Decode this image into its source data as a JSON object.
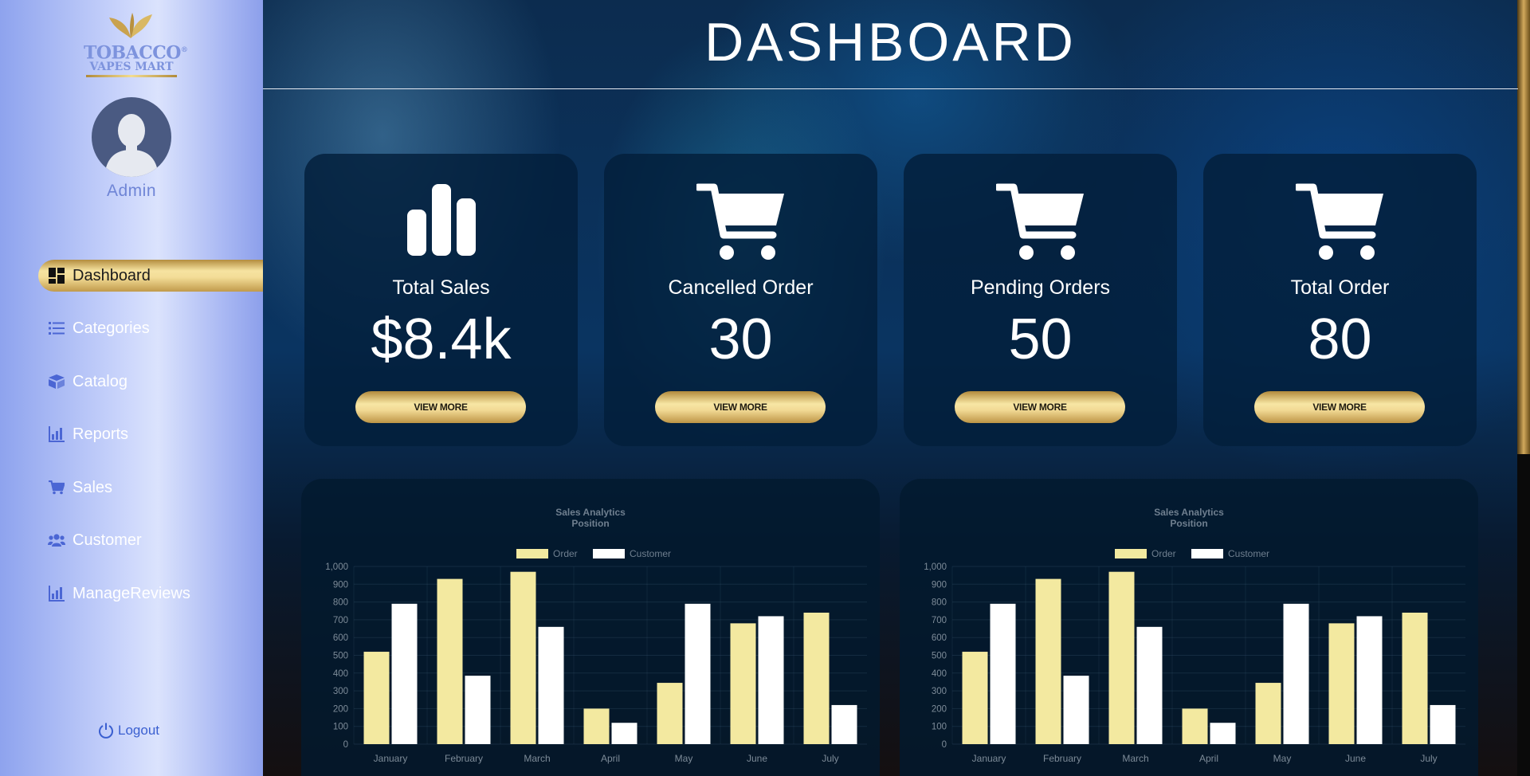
{
  "brand": {
    "line1": "TOBACCO",
    "line2": "VAPES MART",
    "registered": "®"
  },
  "user": {
    "name": "Admin"
  },
  "nav": [
    {
      "label": "Dashboard",
      "icon": "dashboard-icon",
      "active": true
    },
    {
      "label": "Categories",
      "icon": "list-icon",
      "active": false
    },
    {
      "label": "Catalog",
      "icon": "box-icon",
      "active": false
    },
    {
      "label": "Reports",
      "icon": "bar-chart-icon",
      "active": false
    },
    {
      "label": "Sales",
      "icon": "cart-icon",
      "active": false
    },
    {
      "label": "Customer",
      "icon": "users-icon",
      "active": false
    },
    {
      "label": "ManageReviews",
      "icon": "bar-chart-icon",
      "active": false
    }
  ],
  "logout": {
    "label": "Logout"
  },
  "page": {
    "title": "DASHBOARD"
  },
  "stats": [
    {
      "label": "Total Sales",
      "value": "$8.4k",
      "button": "VIEW MORE",
      "icon": "bar-chart-icon"
    },
    {
      "label": "Cancelled Order",
      "value": "30",
      "button": "VIEW MORE",
      "icon": "cart-icon"
    },
    {
      "label": "Pending Orders",
      "value": "50",
      "button": "VIEW MORE",
      "icon": "cart-icon"
    },
    {
      "label": "Total Order",
      "value": "80",
      "button": "VIEW MORE",
      "icon": "cart-icon"
    }
  ],
  "colors": {
    "gold": "#f2dc91",
    "order_bar": "#f3e9a0",
    "customer_bar": "#ffffff",
    "card_bg": "#031e3a",
    "sidebar": "#a9b8f3"
  },
  "chart_data": [
    {
      "type": "bar",
      "title": [
        "Sales Analytics",
        "Position"
      ],
      "categories": [
        "January",
        "February",
        "March",
        "April",
        "May",
        "June",
        "July"
      ],
      "series": [
        {
          "name": "Order",
          "values": [
            520,
            930,
            970,
            200,
            345,
            680,
            740
          ]
        },
        {
          "name": "Customer",
          "values": [
            790,
            385,
            660,
            120,
            790,
            720,
            220
          ]
        }
      ],
      "ylim": [
        0,
        1000
      ],
      "yticks": [
        "0",
        "100",
        "200",
        "300",
        "400",
        "500",
        "600",
        "700",
        "800",
        "900",
        "1,000"
      ],
      "legend": "top",
      "grid": true
    },
    {
      "type": "bar",
      "title": [
        "Sales Analytics",
        "Position"
      ],
      "categories": [
        "January",
        "February",
        "March",
        "April",
        "May",
        "June",
        "July"
      ],
      "series": [
        {
          "name": "Order",
          "values": [
            520,
            930,
            970,
            200,
            345,
            680,
            740
          ]
        },
        {
          "name": "Customer",
          "values": [
            790,
            385,
            660,
            120,
            790,
            720,
            220
          ]
        }
      ],
      "ylim": [
        0,
        1000
      ],
      "yticks": [
        "0",
        "100",
        "200",
        "300",
        "400",
        "500",
        "600",
        "700",
        "800",
        "900",
        "1,000"
      ],
      "legend": "top",
      "grid": true
    }
  ]
}
